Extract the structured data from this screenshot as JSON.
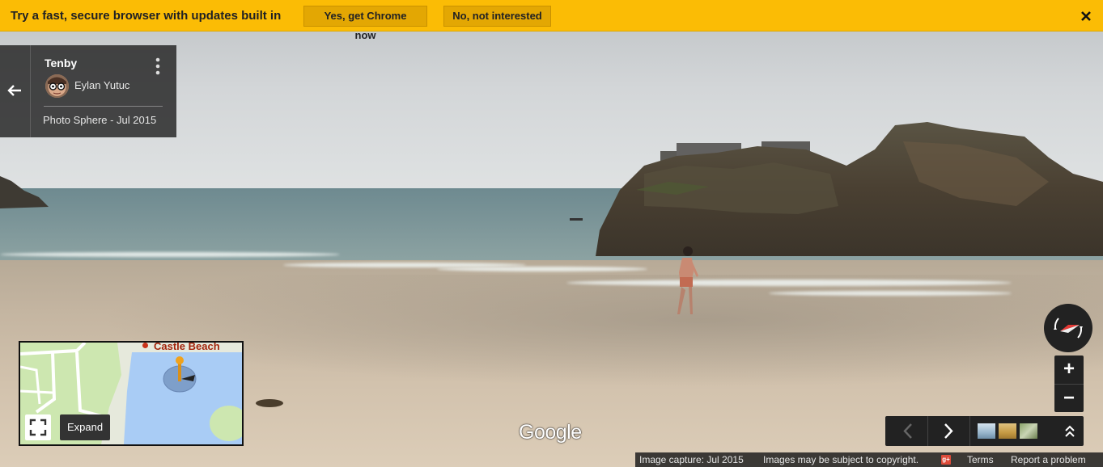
{
  "infobar": {
    "message": "Try a fast, secure browser with updates built in",
    "accept_label": "Yes, get Chrome now",
    "decline_label": "No, not interested",
    "close_icon": "close-icon"
  },
  "info_card": {
    "title": "Tenby",
    "author": "Eylan Yutuc",
    "photo_meta": "Photo Sphere - Jul 2015",
    "back_icon": "back-arrow-icon",
    "menu_icon": "more-vert-icon"
  },
  "minimap": {
    "place_label": "Castle Beach",
    "expand_label": "Expand",
    "colors": {
      "water": "#a9ccf5",
      "land": "#cde7b0",
      "roads": "#ffffff"
    }
  },
  "controls": {
    "zoom_in": "+",
    "zoom_out": "−"
  },
  "logo": "Google",
  "footer": {
    "capture": "Image capture: Jul 2015",
    "copyright": "Images may be subject to copyright.",
    "terms": "Terms",
    "report": "Report a problem"
  },
  "colors": {
    "infobar": "#fbbc05",
    "panel": "#222222"
  }
}
